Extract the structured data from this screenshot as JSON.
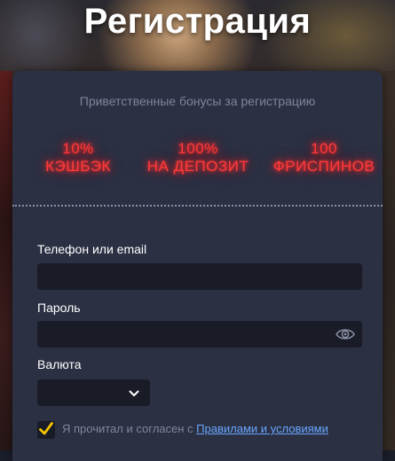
{
  "page": {
    "title": "Регистрация"
  },
  "promo": {
    "subtitle": "Приветственные бонусы за регистрацию",
    "bonuses": [
      {
        "line1": "10%",
        "line2": "КЭШБЭК"
      },
      {
        "line1": "100%",
        "line2": "НА ДЕПОЗИТ"
      },
      {
        "line1": "100",
        "line2": "ФРИСПИНОВ"
      }
    ],
    "neon_color": "#ff3b3b"
  },
  "form": {
    "phone_label": "Телефон или email",
    "phone_value": "",
    "password_label": "Пароль",
    "password_value": "",
    "currency_label": "Валюта",
    "currency_value": "",
    "agree_text": "Я прочитал и согласен с",
    "terms_link": "Правилами и условиями",
    "agree_checked": true
  },
  "icons": {
    "password_toggle": "eye-icon",
    "dropdown": "chevron-down-icon",
    "check": "checkmark-icon"
  },
  "colors": {
    "panel": "#2b3043",
    "input": "#191b26",
    "link": "#6aa7ff",
    "check": "#f5c400"
  }
}
